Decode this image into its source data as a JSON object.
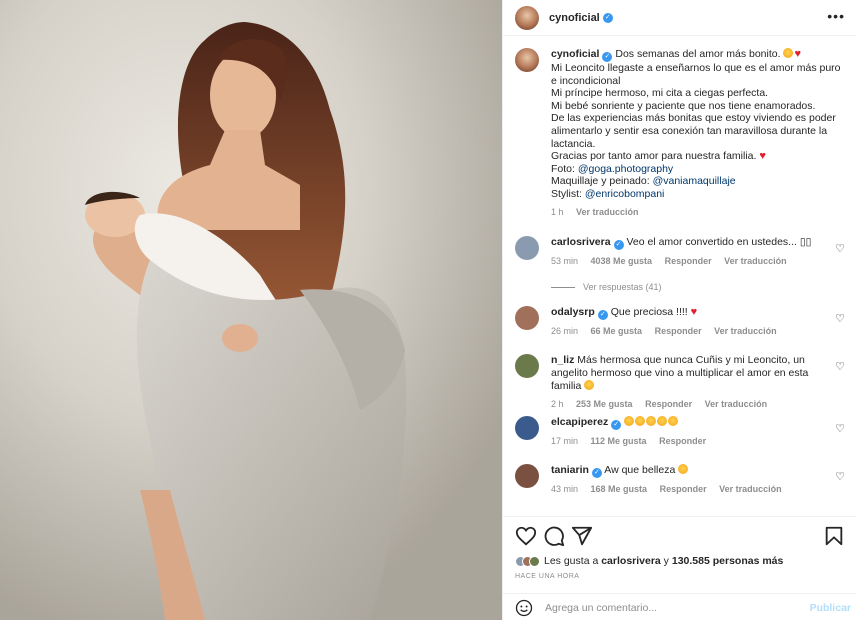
{
  "post": {
    "username": "cynoficial",
    "caption": {
      "username": "cynoficial",
      "lines": [
        "Dos semanas del amor más bonito.",
        "Mi Leoncito llegaste a enseñarnos lo que es el amor más puro e incondicional",
        "Mi príncipe hermoso, mi cita a ciegas perfecta.",
        "Mi bebé sonriente y paciente que nos tiene enamorados.",
        "De las experiencias más bonitas que estoy viviendo es poder alimentarlo y sentir esa conexión tan maravillosa durante la lactancia.",
        "Gracias por tanto amor para nuestra familia."
      ],
      "photo_label": "Foto: ",
      "photo_tag": "@goga.photography",
      "makeup_label": "Maquillaje y peinado: ",
      "makeup_tag": "@vaniamaquillaje",
      "stylist_label": "Stylist: ",
      "stylist_tag": "@enricobompani",
      "time": "1 h",
      "translate": "Ver traducción"
    }
  },
  "comments": [
    {
      "username": "carlosrivera",
      "verified": true,
      "text": "Veo el amor convertido en ustedes... ▯▯",
      "time": "53 min",
      "likes": "4038 Me gusta",
      "reply": "Responder",
      "translate": "Ver traducción",
      "avatar_color": "#8a9bb0"
    },
    {
      "username": "odalysrp",
      "verified": true,
      "text": "Que preciosa !!!!",
      "time": "26 min",
      "likes": "66 Me gusta",
      "reply": "Responder",
      "translate": "Ver traducción",
      "avatar_color": "#a0705a"
    },
    {
      "username": "n_liz",
      "verified": false,
      "text": "Más hermosa que nunca Cuñis y mi Leoncito, un angelito hermoso que vino a multiplicar el amor en esta familia",
      "time": "2 h",
      "likes": "253 Me gusta",
      "reply": "Responder",
      "translate": "Ver traducción",
      "avatar_color": "#6b7a4a"
    },
    {
      "username": "elcapiperez",
      "verified": true,
      "text": "",
      "time": "17 min",
      "likes": "112 Me gusta",
      "reply": "Responder",
      "translate": "",
      "avatar_color": "#3b5b8c"
    },
    {
      "username": "taniarin",
      "verified": true,
      "text": "Aw que belleza",
      "time": "43 min",
      "likes": "168 Me gusta",
      "reply": "Responder",
      "translate": "Ver traducción",
      "avatar_color": "#7a5040"
    }
  ],
  "view_replies": "Ver respuestas (41)",
  "likes": {
    "prefix": "Les gusta a ",
    "user": "carlosrivera",
    "middle": " y ",
    "count": "130.585 personas más"
  },
  "timestamp": "HACE UNA HORA",
  "add_comment": {
    "placeholder": "Agrega un comentario...",
    "publish": "Publicar"
  },
  "icons": [
    "heart-icon",
    "comment-icon",
    "share-icon",
    "bookmark-icon",
    "emoji-icon",
    "more-icon",
    "verified-icon"
  ],
  "colors": {
    "verified": "#3897f0",
    "link": "#00376b",
    "muted": "#8e8e8e",
    "publish": "#b2dffc",
    "heart": "#e0202e"
  }
}
